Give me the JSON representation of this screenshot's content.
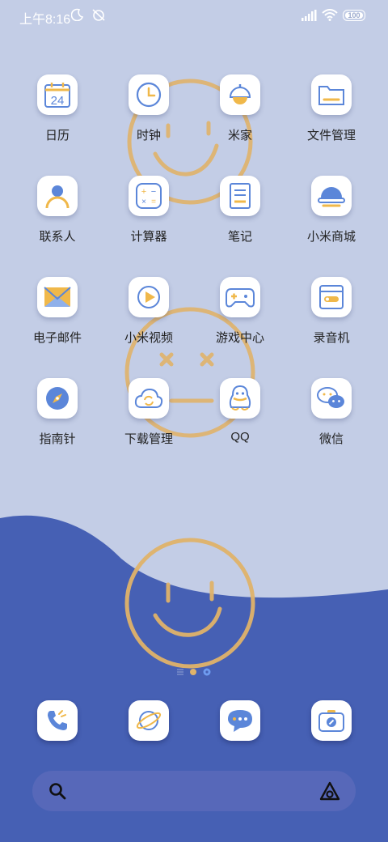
{
  "status_bar": {
    "time": "上午8:16",
    "battery": "100",
    "icons": [
      "moon-icon",
      "mute-alarm-icon",
      "signal-icon",
      "wifi-icon",
      "battery-icon"
    ]
  },
  "apps": [
    {
      "label": "日历",
      "icon": "calendar-icon",
      "date": "24"
    },
    {
      "label": "时钟",
      "icon": "clock-icon"
    },
    {
      "label": "米家",
      "icon": "mijia-lamp-icon"
    },
    {
      "label": "文件管理",
      "icon": "folder-icon"
    },
    {
      "label": "联系人",
      "icon": "contacts-icon"
    },
    {
      "label": "计算器",
      "icon": "calculator-icon"
    },
    {
      "label": "笔记",
      "icon": "notes-icon"
    },
    {
      "label": "小米商城",
      "icon": "mi-store-icon"
    },
    {
      "label": "电子邮件",
      "icon": "email-icon"
    },
    {
      "label": "小米视频",
      "icon": "video-icon"
    },
    {
      "label": "游戏中心",
      "icon": "gamepad-icon"
    },
    {
      "label": "录音机",
      "icon": "recorder-icon"
    },
    {
      "label": "指南针",
      "icon": "compass-icon"
    },
    {
      "label": "下载管理",
      "icon": "download-cloud-icon"
    },
    {
      "label": "QQ",
      "icon": "qq-penguin-icon"
    },
    {
      "label": "微信",
      "icon": "wechat-icon"
    }
  ],
  "dock": [
    "phone-icon",
    "browser-planet-icon",
    "messages-icon",
    "camera-icon"
  ],
  "colors": {
    "wallpaper_top": "#c3cde6",
    "wallpaper_bottom": "#4660b4",
    "accent_orange": "#f0b84a",
    "accent_blue": "#5b86d9",
    "smiley": "#e0b36a"
  }
}
